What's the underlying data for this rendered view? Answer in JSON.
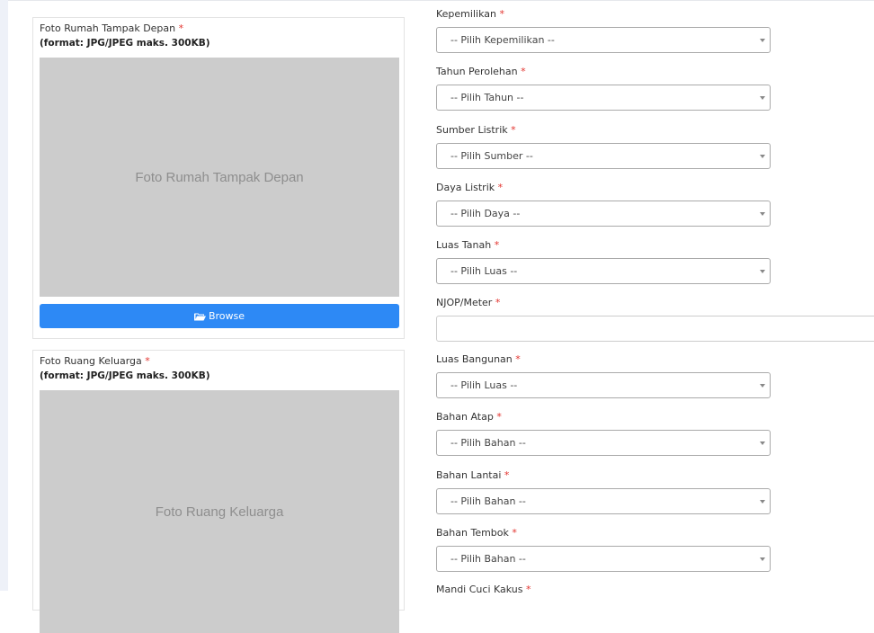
{
  "uploads": [
    {
      "title": "Foto Rumah Tampak Depan",
      "required": "*",
      "note": "(format: JPG/JPEG maks. 300KB)",
      "placeholder": "Foto Rumah Tampak Depan",
      "button": "Browse"
    },
    {
      "title": "Foto Ruang Keluarga",
      "required": "*",
      "note": "(format: JPG/JPEG maks. 300KB)",
      "placeholder": "Foto Ruang Keluarga"
    }
  ],
  "form": {
    "required_mark": "*",
    "fields": [
      {
        "label": "Kepemilikan",
        "type": "select",
        "value": "-- Pilih Kepemilikan --"
      },
      {
        "label": "Tahun Perolehan",
        "type": "select",
        "value": "-- Pilih Tahun --"
      },
      {
        "label": "Sumber Listrik",
        "type": "select",
        "value": "-- Pilih Sumber --"
      },
      {
        "label": "Daya Listrik",
        "type": "select",
        "value": "-- Pilih Daya --"
      },
      {
        "label": "Luas Tanah",
        "type": "select",
        "value": "-- Pilih Luas --"
      },
      {
        "label": "NJOP/Meter",
        "type": "text",
        "value": ""
      },
      {
        "label": "Luas Bangunan",
        "type": "select",
        "value": "-- Pilih Luas --"
      },
      {
        "label": "Bahan Atap",
        "type": "select",
        "value": "-- Pilih Bahan --"
      },
      {
        "label": "Bahan Lantai",
        "type": "select",
        "value": "-- Pilih Bahan --"
      },
      {
        "label": "Bahan Tembok",
        "type": "select",
        "value": "-- Pilih Bahan --"
      },
      {
        "label": "Mandi Cuci Kakus",
        "type": "select",
        "value": ""
      }
    ]
  },
  "icons": {
    "browse": "folder-open-icon"
  },
  "colors": {
    "accent": "#2d89f5",
    "required": "#e3342f",
    "preview_bg": "#cccccc"
  }
}
